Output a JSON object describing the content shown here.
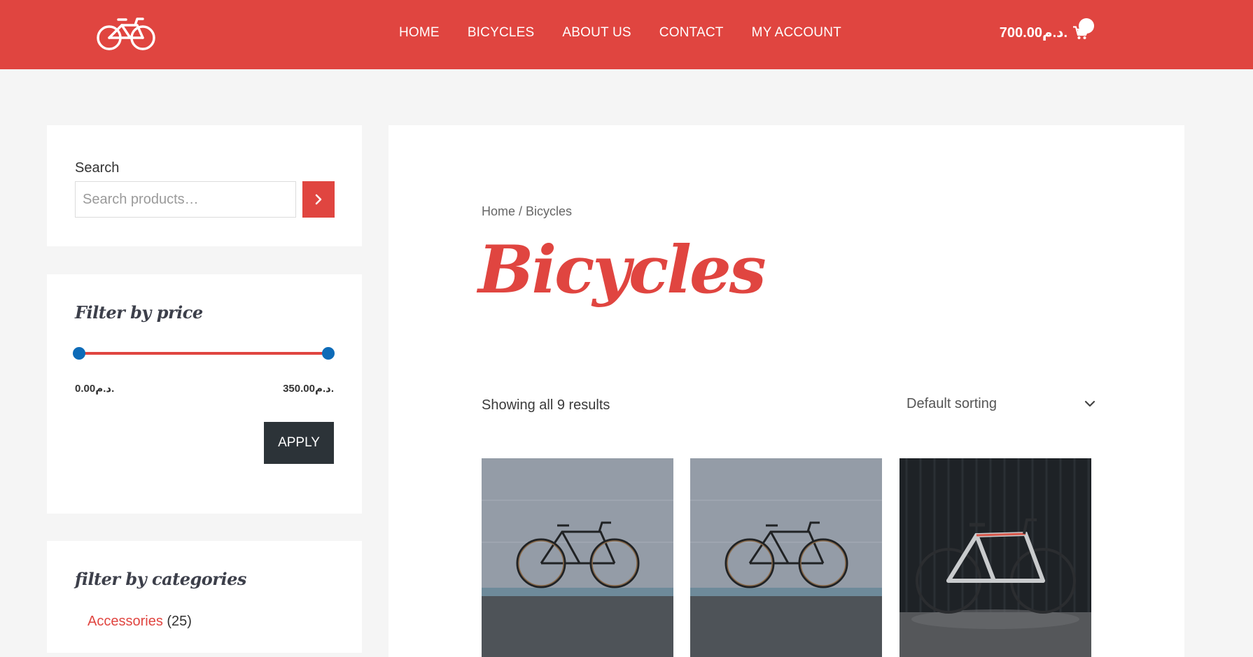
{
  "nav": {
    "items": [
      "HOME",
      "BICYCLES",
      "ABOUT US",
      "CONTACT",
      "MY ACCOUNT"
    ]
  },
  "cart": {
    "amount": "700.00د.م.",
    "icon": "cart-icon"
  },
  "sidebar": {
    "search": {
      "label": "Search",
      "placeholder": "Search products…",
      "button_icon": "chevron-right-icon"
    },
    "price_filter": {
      "title": "Filter by price",
      "min_label": "0.00د.م.",
      "max_label": "350.00د.م.",
      "apply_label": "APPLY"
    },
    "categories": {
      "title": "filter by categories",
      "items": [
        {
          "name": "Accessories",
          "count": "(25)"
        }
      ]
    }
  },
  "main": {
    "breadcrumb": {
      "home": "Home",
      "separator": " / ",
      "current": "Bicycles"
    },
    "title": "Bicycles",
    "result_count": "Showing all 9 results",
    "sorting": {
      "selected": "Default sorting"
    }
  },
  "colors": {
    "brand": "#e04540",
    "slider_handle": "#0d6bb8",
    "dark_button": "#2c3338"
  }
}
